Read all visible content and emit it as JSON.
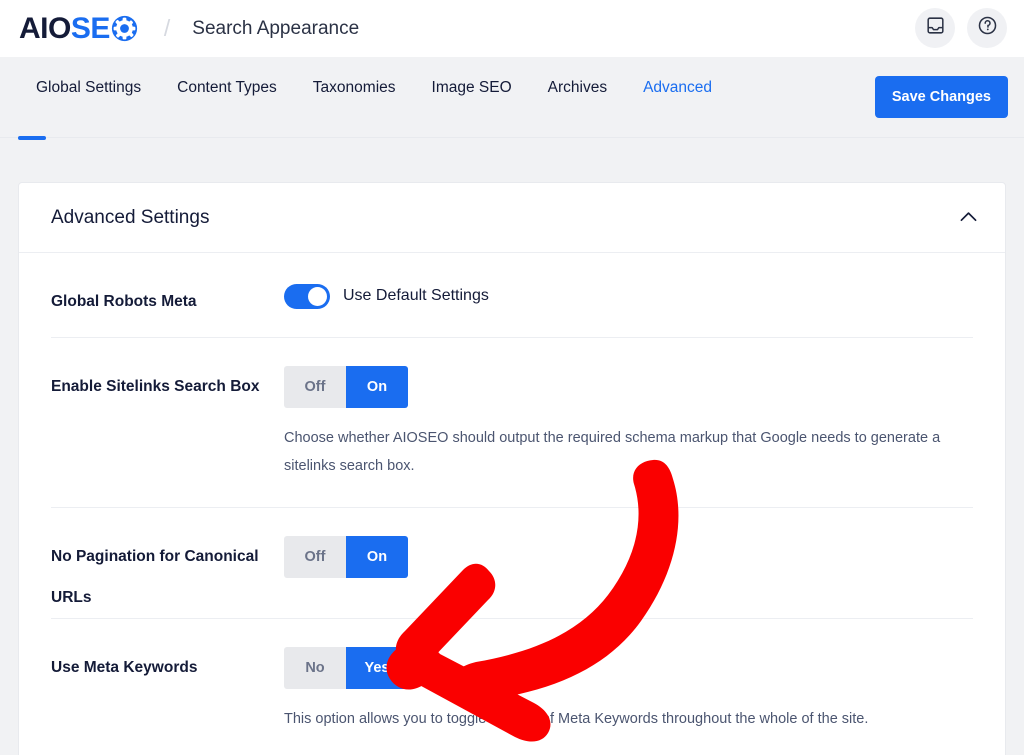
{
  "header": {
    "logo_aio": "AIO",
    "logo_se": "SE",
    "logo_gear_icon": "gear-o-icon",
    "breadcrumb_separator": "/",
    "page_title": "Search Appearance",
    "actions": [
      {
        "icon": "inbox-icon",
        "name": "notifications-button"
      },
      {
        "icon": "help-question-icon",
        "name": "help-button"
      }
    ]
  },
  "tabs": [
    {
      "label": "Global Settings",
      "active": false
    },
    {
      "label": "Content Types",
      "active": false
    },
    {
      "label": "Taxonomies",
      "active": false
    },
    {
      "label": "Image SEO",
      "active": false
    },
    {
      "label": "Archives",
      "active": false
    },
    {
      "label": "Advanced",
      "active": true
    }
  ],
  "save_button": {
    "label": "Save Changes"
  },
  "panel": {
    "title": "Advanced Settings",
    "collapse_icon": "chevron-up-icon",
    "rows": [
      {
        "label": "Global Robots Meta",
        "control": "toggle",
        "toggle_on": true,
        "toggle_label": "Use Default Settings",
        "description": ""
      },
      {
        "label": "Enable Sitelinks Search Box",
        "control": "segmented",
        "options": [
          "Off",
          "On"
        ],
        "selected": "On",
        "description": "Choose whether AIOSEO should output the required schema markup that Google needs to generate a sitelinks search box."
      },
      {
        "label": "No Pagination for Canonical URLs",
        "control": "segmented",
        "options": [
          "Off",
          "On"
        ],
        "selected": "On",
        "description": ""
      },
      {
        "label": "Use Meta Keywords",
        "control": "segmented",
        "options": [
          "No",
          "Yes"
        ],
        "selected": "Yes",
        "description": "This option allows you to toggle the use of Meta Keywords throughout the whole of the site."
      }
    ]
  },
  "annotation": {
    "type": "curved-arrow",
    "color": "#fa0000",
    "points_to": "Use Meta Keywords toggle"
  },
  "colors": {
    "accent_blue": "#1a6df0",
    "dark_navy": "#141b38",
    "page_bg": "#f1f2f4",
    "annotation_red": "#fa0000"
  }
}
